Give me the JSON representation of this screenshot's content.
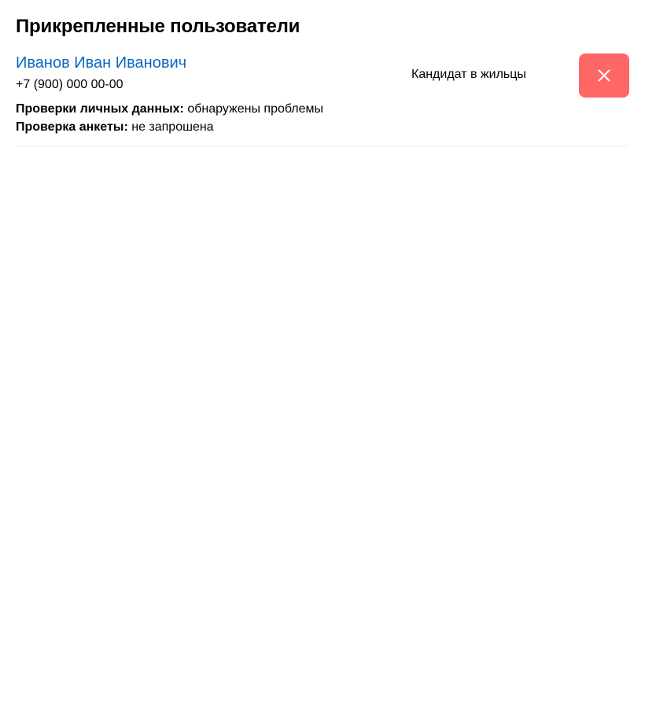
{
  "page": {
    "title": "Прикрепленные пользователи"
  },
  "users": [
    {
      "name": "Иванов Иван Иванович",
      "phone": "+7 (900) 000 00-00",
      "personal_check_label": "Проверки личных данных:",
      "personal_check_value": " обнаружены проблемы",
      "form_check_label": "Проверка анкеты:",
      "form_check_value": " не запрошена",
      "role": "Кандидат в жильцы",
      "remove_icon": "close-icon"
    }
  ],
  "colors": {
    "link": "#0a68c4",
    "remove_button": "#ff6666",
    "divider": "#ebebeb"
  }
}
